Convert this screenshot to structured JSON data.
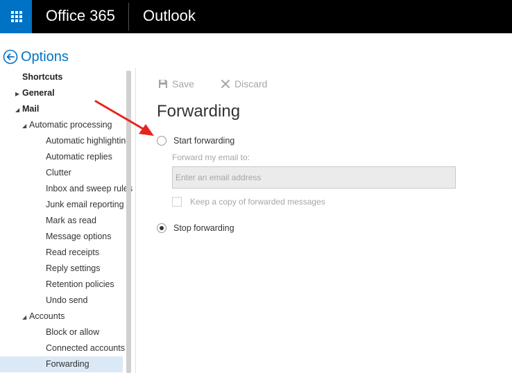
{
  "header": {
    "brand": "Office 365",
    "app": "Outlook"
  },
  "options": {
    "label": "Options"
  },
  "nav": {
    "items": [
      {
        "label": "Shortcuts",
        "level": 0,
        "expander": "",
        "bold": true
      },
      {
        "label": "General",
        "level": 0,
        "expander": "collapsed",
        "bold": true
      },
      {
        "label": "Mail",
        "level": 0,
        "expander": "expanded",
        "bold": true
      },
      {
        "label": "Automatic processing",
        "level": 1,
        "expander": "expanded",
        "bold": false
      },
      {
        "label": "Automatic highlighting",
        "level": 2,
        "expander": "",
        "bold": false
      },
      {
        "label": "Automatic replies",
        "level": 2,
        "expander": "",
        "bold": false
      },
      {
        "label": "Clutter",
        "level": 2,
        "expander": "",
        "bold": false
      },
      {
        "label": "Inbox and sweep rules",
        "level": 2,
        "expander": "",
        "bold": false
      },
      {
        "label": "Junk email reporting",
        "level": 2,
        "expander": "",
        "bold": false
      },
      {
        "label": "Mark as read",
        "level": 2,
        "expander": "",
        "bold": false
      },
      {
        "label": "Message options",
        "level": 2,
        "expander": "",
        "bold": false
      },
      {
        "label": "Read receipts",
        "level": 2,
        "expander": "",
        "bold": false
      },
      {
        "label": "Reply settings",
        "level": 2,
        "expander": "",
        "bold": false
      },
      {
        "label": "Retention policies",
        "level": 2,
        "expander": "",
        "bold": false
      },
      {
        "label": "Undo send",
        "level": 2,
        "expander": "",
        "bold": false
      },
      {
        "label": "Accounts",
        "level": 1,
        "expander": "expanded",
        "bold": false
      },
      {
        "label": "Block or allow",
        "level": 2,
        "expander": "",
        "bold": false
      },
      {
        "label": "Connected accounts",
        "level": 2,
        "expander": "",
        "bold": false
      },
      {
        "label": "Forwarding",
        "level": 2,
        "expander": "",
        "bold": false,
        "selected": true
      }
    ]
  },
  "toolbar": {
    "save_label": "Save",
    "discard_label": "Discard"
  },
  "page": {
    "title": "Forwarding",
    "start_forwarding_label": "Start forwarding",
    "forward_to_label": "Forward my email to:",
    "email_placeholder": "Enter an email address",
    "email_value": "",
    "keep_copy_label": "Keep a copy of forwarded messages",
    "stop_forwarding_label": "Stop forwarding",
    "selected_option": "stop_forwarding"
  },
  "colors": {
    "accent": "#0072c6",
    "topbar": "#000000",
    "selected_nav": "#dbe9f7",
    "annotation_arrow": "#e8231e"
  },
  "icons": {
    "app_launcher": "waffle-icon",
    "back": "back-arrow-icon",
    "save": "floppy-disk-icon",
    "discard": "x-icon"
  }
}
